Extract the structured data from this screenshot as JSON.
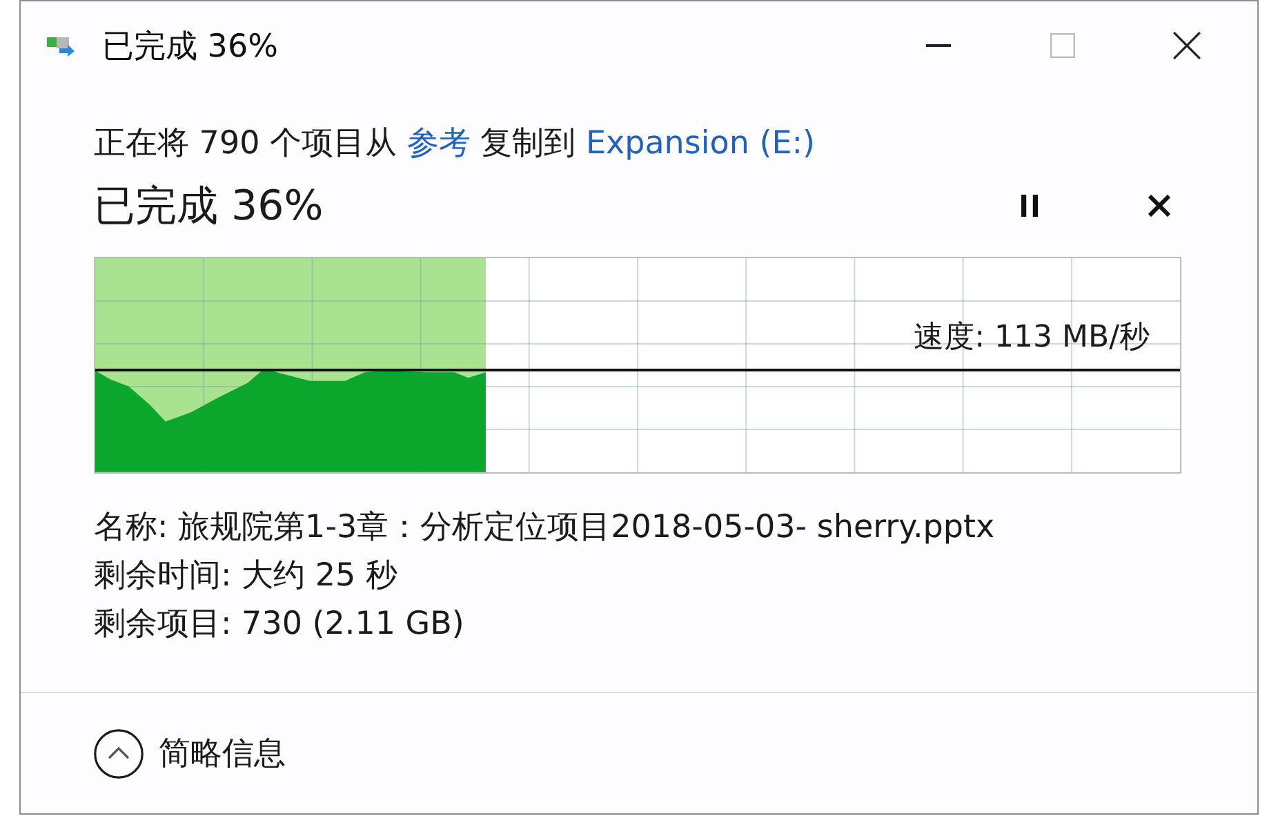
{
  "window": {
    "title": "已完成 36%"
  },
  "copy_status": [
    {
      "kind": "text",
      "text": "正在将 790 个项目从"
    },
    {
      "kind": "link",
      "text": "参考"
    },
    {
      "kind": "text",
      "text": "复制到"
    },
    {
      "kind": "link",
      "text": "Expansion (E:)"
    }
  ],
  "progress": {
    "title": "已完成 36%",
    "level": 0.36,
    "speed": "速度: 113 MB/秒"
  },
  "details": [
    "名称: 旅规院第1-3章：分析定位项目2018-05-03- sherry.pptx",
    "剩余时间: 大约 25 秒",
    "剩余项目: 730 (2.11 GB)"
  ],
  "footer": {
    "label": "简略信息",
    "expanded": true
  }
}
